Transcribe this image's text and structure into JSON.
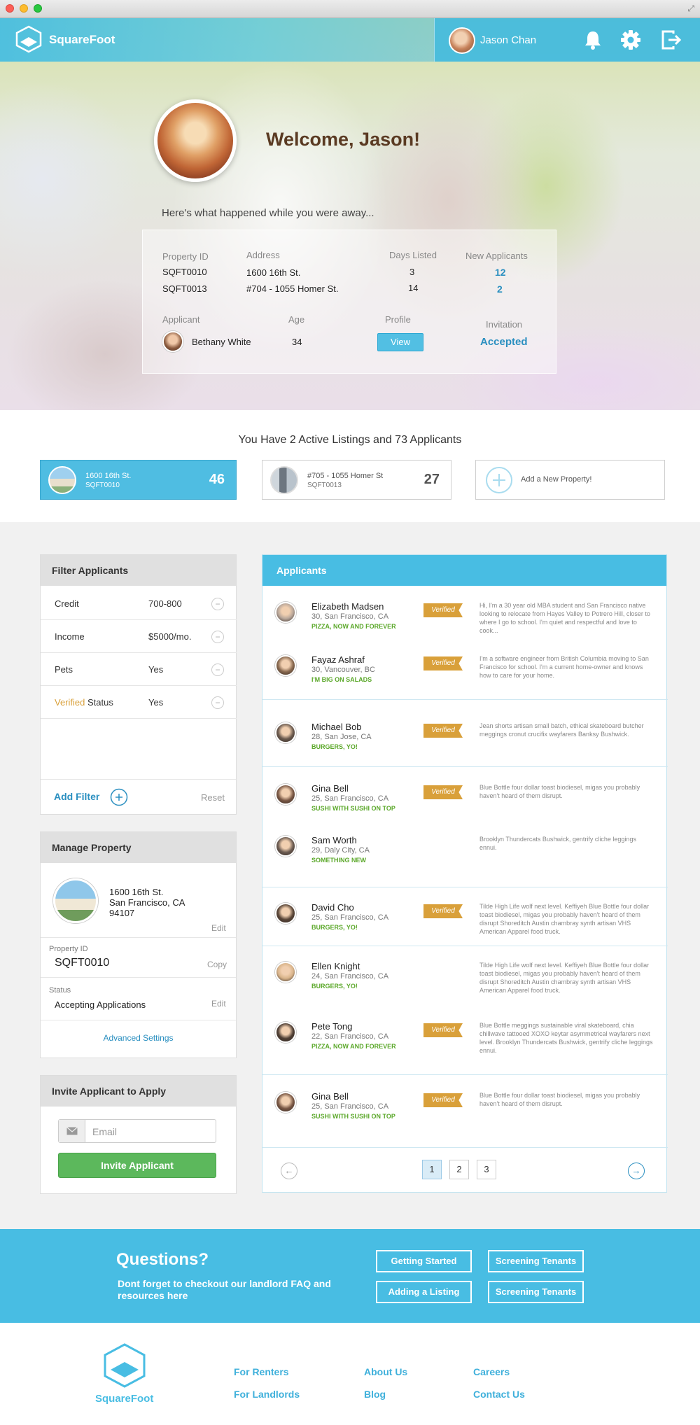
{
  "header": {
    "brand": "SquareFoot",
    "user_name": "Jason Chan"
  },
  "hero": {
    "welcome": "Welcome, Jason!",
    "away_text": "Here's what happened while you were away...",
    "summary": {
      "col_property_id": "Property ID",
      "col_address": "Address",
      "col_days_listed": "Days Listed",
      "col_new_applicants": "New Applicants",
      "rows": [
        {
          "id": "SQFT0010",
          "address": "1600 16th St.",
          "days": "3",
          "new_applicants": "12"
        },
        {
          "id": "SQFT0013",
          "address": "#704 - 1055 Homer St.",
          "days": "14",
          "new_applicants": "2"
        }
      ],
      "col_applicant": "Applicant",
      "col_age": "Age",
      "col_profile": "Profile",
      "col_invitation": "Invitation",
      "applicant": {
        "name": "Bethany White",
        "age": "34",
        "profile_button": "View",
        "invitation": "Accepted"
      }
    }
  },
  "listings": {
    "title": "You Have 2 Active Listings and 73 Applicants",
    "cards": [
      {
        "line1": "1600 16th St.",
        "line2": "SQFT0010",
        "count": "46"
      },
      {
        "line1": "#705 - 1055 Homer St",
        "line2": "SQFT0013",
        "count": "27"
      }
    ],
    "add_label": "Add a New Property!"
  },
  "filter": {
    "title": "Filter Applicants",
    "rows": [
      {
        "label": "Credit",
        "value": "700-800"
      },
      {
        "label": "Income",
        "value": "$5000/mo."
      },
      {
        "label": "Pets",
        "value": "Yes"
      },
      {
        "label_highlight": "Verified",
        "label": " Status",
        "value": "Yes"
      }
    ],
    "add_filter": "Add Filter",
    "reset": "Reset"
  },
  "manage": {
    "title": "Manage Property",
    "address_line1": "1600 16th St.",
    "address_line2": "San Francisco, CA",
    "address_line3": "94107",
    "edit": "Edit",
    "property_id_label": "Property ID",
    "property_id": "SQFT0010",
    "copy": "Copy",
    "status_label": "Status",
    "status": "Accepting Applications",
    "edit2": "Edit",
    "advanced": "Advanced Settings"
  },
  "invite": {
    "title": "Invite Applicant to Apply",
    "email_placeholder": "Email",
    "button": "Invite Applicant"
  },
  "applicants": {
    "title": "Applicants",
    "verified_label": "Verified",
    "items": [
      {
        "name": "Elizabeth Madsen",
        "sub": "30, San Francisco, CA",
        "tag": "PIZZA, NOW AND FOREVER",
        "verified": true,
        "desc": "Hi, I'm a 30 year old MBA student and San Francisco native looking to relocate from Hayes Valley to Potrero Hill, closer to where I go to school. I'm quiet and respectful and love to cook...",
        "tone": "#b9a79a"
      },
      {
        "name": "Fayaz Ashraf",
        "sub": "30, Vancouver, BC",
        "tag": "I'M BIG ON SALADS",
        "verified": true,
        "desc": "I'm a software engineer from British Columbia moving to San Francisco for school. I'm a current home-owner and knows how to care for your home.",
        "tone": "#8a6a50"
      },
      {
        "name": "Michael Bob",
        "sub": "28, San Jose, CA",
        "tag": "BURGERS, YO!",
        "verified": true,
        "desc": "Jean shorts artisan small batch, ethical skateboard butcher meggings cronut crucifix wayfarers Banksy Bushwick.",
        "tone": "#6b5a4e"
      },
      {
        "name": "Gina Bell",
        "sub": "25, San Francisco, CA",
        "tag": "SUSHI WITH SUSHI ON TOP",
        "verified": true,
        "desc": "Blue Bottle four dollar toast biodiesel, migas you probably haven't heard of them disrupt.",
        "tone": "#7a5845"
      },
      {
        "name": "Sam Worth",
        "sub": "29, Daly City, CA",
        "tag": "SOMETHING NEW",
        "verified": false,
        "desc": "Brooklyn Thundercats Bushwick, gentrify cliche leggings ennui.",
        "tone": "#6c5c52"
      },
      {
        "name": "David Cho",
        "sub": "25, San Francisco, CA",
        "tag": "BURGERS, YO!",
        "verified": true,
        "desc": "Tilde High Life wolf next level. Keffiyeh Blue Bottle four dollar toast biodiesel, migas you probably haven't heard of them disrupt Shoreditch Austin chambray synth artisan VHS American Apparel food truck.",
        "tone": "#5a4638"
      },
      {
        "name": "Ellen Knight",
        "sub": "24, San Francisco, CA",
        "tag": "BURGERS, YO!",
        "verified": false,
        "desc": "Tilde High Life wolf next level. Keffiyeh Blue Bottle four dollar toast biodiesel, migas you probably haven't heard of them disrupt Shoreditch Austin chambray synth artisan VHS American Apparel food truck.",
        "tone": "#d9b48a"
      },
      {
        "name": "Pete Tong",
        "sub": "22, San Francisco, CA",
        "tag": "PIZZA, NOW AND FOREVER",
        "verified": true,
        "desc": "Blue Bottle meggings sustainable viral skateboard, chia chillwave tattooed XOXO keytar asymmetrical wayfarers next level. Brooklyn Thundercats Bushwick, gentrify cliche leggings ennui.",
        "tone": "#4f3f35"
      },
      {
        "name": "Gina Bell",
        "sub": "25, San Francisco, CA",
        "tag": "SUSHI WITH SUSHI ON TOP",
        "verified": true,
        "desc": "Blue Bottle four dollar toast biodiesel, migas you probably haven't heard of them disrupt.",
        "tone": "#7a5845"
      }
    ],
    "pages": [
      "1",
      "2",
      "3"
    ],
    "current_page": "1"
  },
  "questions": {
    "title": "Questions?",
    "subtitle": "Dont forget to checkout our landlord FAQ and resources here",
    "buttons": [
      "Getting Started",
      "Screening Tenants",
      "Adding a Listing",
      "Screening Tenants"
    ]
  },
  "footer": {
    "brand": "SquareFoot",
    "links": [
      "For Renters",
      "For Landlords",
      "About Us",
      "Blog",
      "Careers",
      "Contact Us"
    ]
  },
  "colors": {
    "accent": "#48bde3",
    "verified": "#d9a03a",
    "tag_green": "#5ba82a",
    "invite_green": "#5cb85c"
  }
}
